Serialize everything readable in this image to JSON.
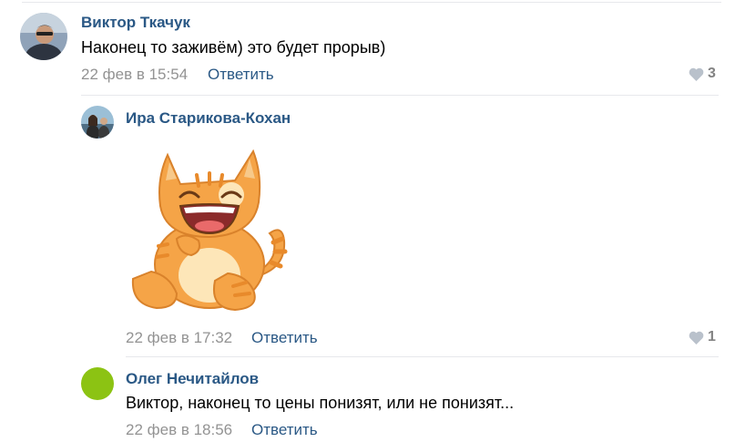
{
  "comments": [
    {
      "author": "Виктор Ткачук",
      "text": "Наконец то заживём) это будет прорыв)",
      "date": "22 фев в 15:54",
      "reply_label": "Ответить",
      "likes": "3"
    },
    {
      "author": "Ира Старикова-Кохан",
      "sticker": "laughing-cat-sticker",
      "date": "22 фев в 17:32",
      "reply_label": "Ответить",
      "likes": "1"
    },
    {
      "author": "Олег Нечитайлов",
      "text": "Виктор, наконец то цены понизят, или не понизят...",
      "date": "22 фев в 18:56",
      "reply_label": "Ответить"
    }
  ],
  "colors": {
    "link": "#2a5885",
    "meta": "#939393",
    "divider": "#e7e8ec",
    "avatar3": "#8cc313",
    "cat_orange": "#f5a447"
  },
  "icons": {
    "like": "heart-icon"
  }
}
